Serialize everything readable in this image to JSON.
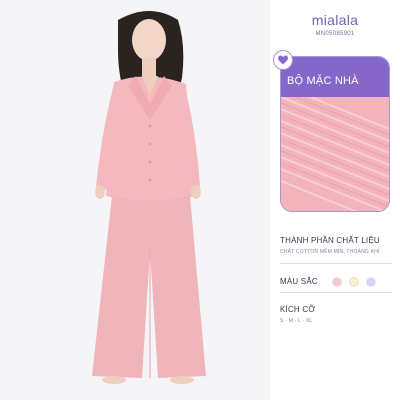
{
  "brand": "mialala",
  "sku": "MN05085901",
  "card": {
    "title": "BỘ MẶC NHÀ"
  },
  "icons": {
    "heart": "heart-icon"
  },
  "material": {
    "title": "THÀNH PHẦN CHẤT LIỆU",
    "desc": "CHẤT COTTON MỀM MỊN, THOÁNG KHÍ"
  },
  "colors": {
    "title": "MÀU SẮC",
    "swatches": [
      "#f6c9cf",
      "#f8f1c6",
      "#d6d3f3"
    ]
  },
  "sizes": {
    "title": "KÍCH CỠ",
    "list": "S · M · L · XL"
  },
  "theme": {
    "accent": "#8567c9",
    "pajama": "#f3b9bf"
  }
}
